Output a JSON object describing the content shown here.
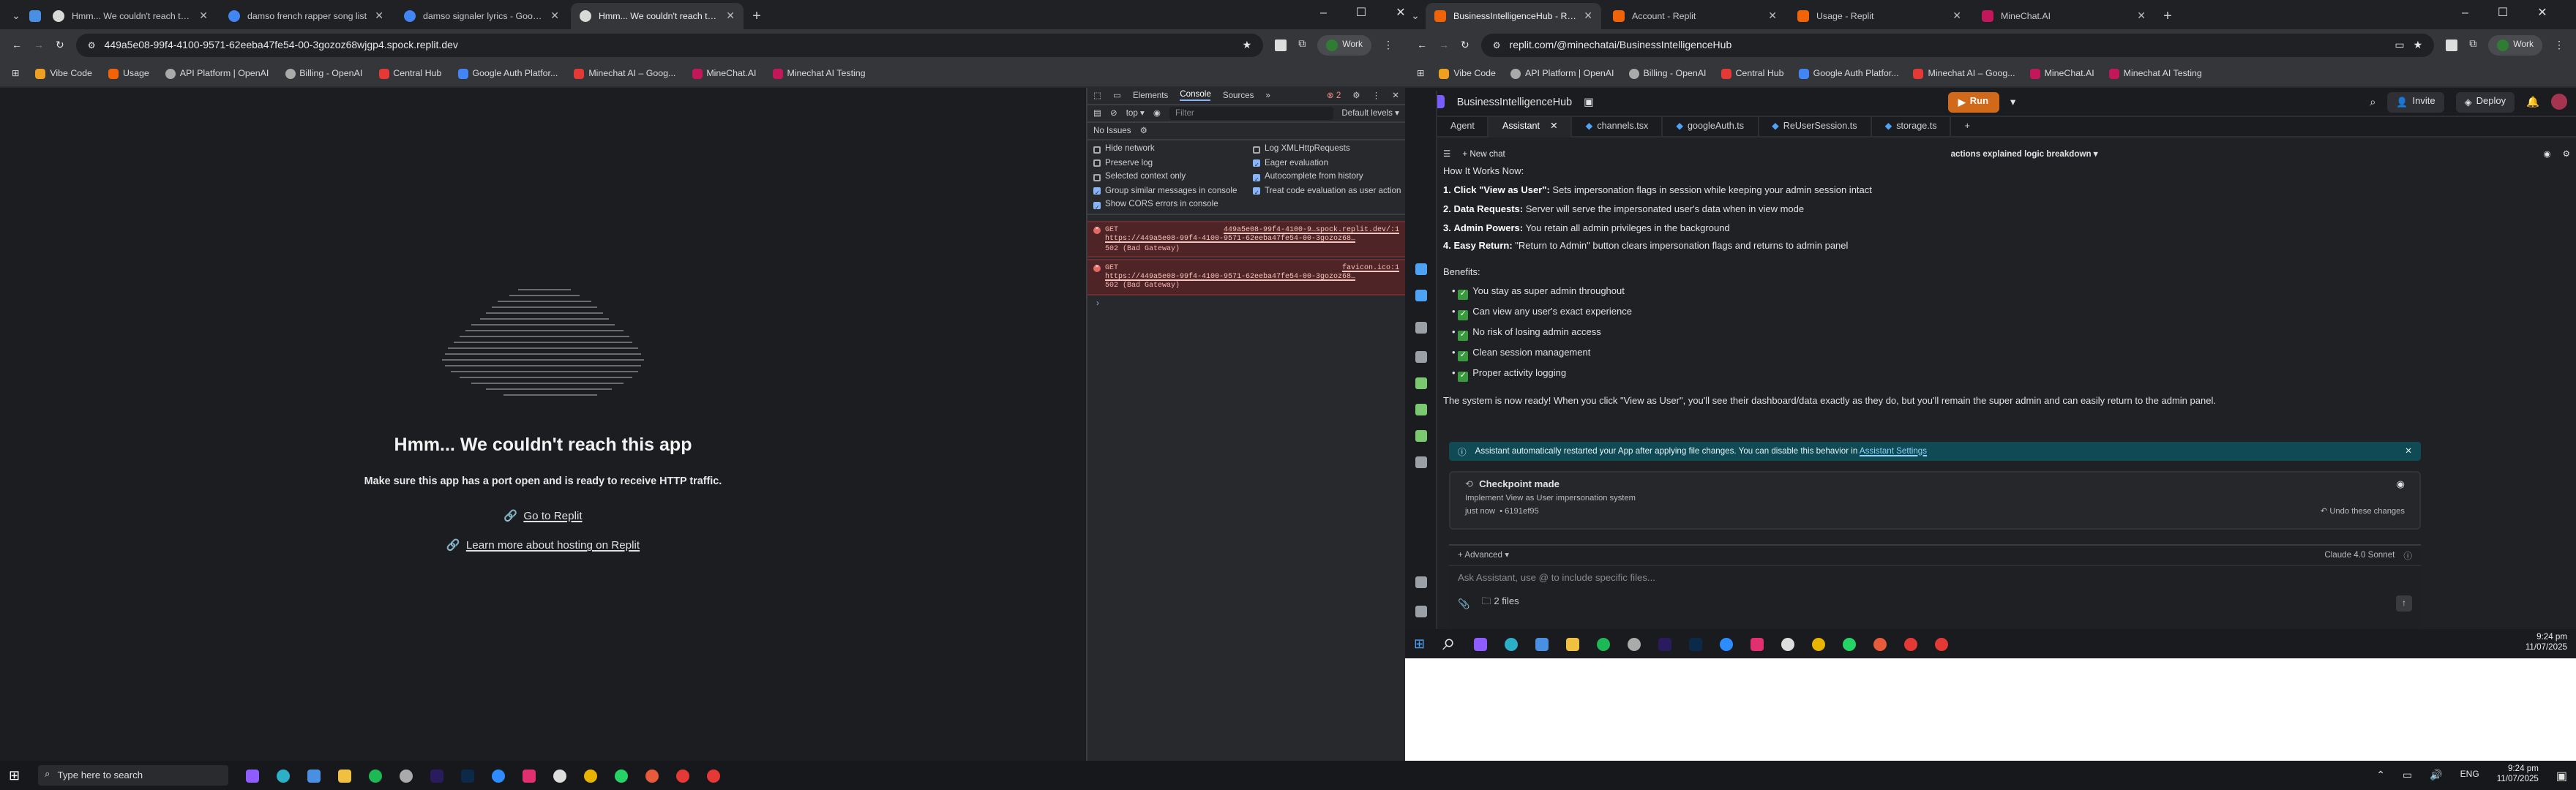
{
  "left_window": {
    "tabs": [
      {
        "title": "Hmm... We couldn't reach this",
        "active": false
      },
      {
        "title": "damso french rapper song list",
        "active": false
      },
      {
        "title": "damso signaler lyrics - Google",
        "active": false
      },
      {
        "title": "Hmm... We couldn't reach this",
        "active": true
      }
    ],
    "url": "449a5e08-99f4-4100-9571-62eeba47fe54-00-3gozoz68wjgp4.spock.replit.dev",
    "profile": "Work",
    "bookmarks": [
      "Vibe Code",
      "Usage",
      "API Platform | OpenAI",
      "Billing - OpenAI",
      "Central Hub",
      "Google Auth Platfor...",
      "Minechat AI – Goog...",
      "MineChat.AI",
      "Minechat AI Testing"
    ],
    "error_page": {
      "title": "Hmm... We couldn't reach this app",
      "subtitle": "Make sure this app has a port open and is ready to receive HTTP traffic.",
      "link1": "Go to Replit",
      "link2": "Learn more about hosting on Replit"
    },
    "devtools": {
      "tabs": [
        "Elements",
        "Console",
        "Sources"
      ],
      "active_tab": "Console",
      "error_count": "2",
      "context": "top",
      "filter_placeholder": "Filter",
      "levels": "Default levels",
      "no_issues": "No Issues",
      "settings": [
        {
          "label": "Hide network",
          "checked": false
        },
        {
          "label": "Log XMLHttpRequests",
          "checked": false
        },
        {
          "label": "Preserve log",
          "checked": false
        },
        {
          "label": "Eager evaluation",
          "checked": true
        },
        {
          "label": "Selected context only",
          "checked": false
        },
        {
          "label": "Autocomplete from history",
          "checked": true
        },
        {
          "label": "Group similar messages in console",
          "checked": true
        },
        {
          "label": "Treat code evaluation as user action",
          "checked": true
        },
        {
          "label": "Show CORS errors in console",
          "checked": true
        }
      ],
      "errors": [
        {
          "method": "GET",
          "source": "449a5e08-99f4-4100-9…spock.replit.dev/:1",
          "url": "https://449a5e08-99f4-4100-9571-62eeba47fe54-00-3gozoz68…",
          "status": "502 (Bad Gateway)"
        },
        {
          "method": "GET",
          "source": "favicon.ico:1",
          "url": "https://449a5e08-99f4-4100-9571-62eeba47fe54-00-3gozoz68…",
          "status": "502 (Bad Gateway)"
        }
      ],
      "prompt": "›"
    }
  },
  "right_window": {
    "tabs": [
      {
        "title": "BusinessIntelligenceHub - Repl",
        "active": true
      },
      {
        "title": "Account - Replit",
        "active": false
      },
      {
        "title": "Usage - Replit",
        "active": false
      },
      {
        "title": "MineChat.AI",
        "active": false
      }
    ],
    "url": "replit.com/@minechatai/BusinessIntelligenceHub",
    "profile": "Work",
    "bookmarks": [
      "Vibe Code",
      "API Platform | OpenAI",
      "Billing - OpenAI",
      "Central Hub",
      "Google Auth Platfor...",
      "Minechat AI – Goog...",
      "MineChat.AI",
      "Minechat AI Testing"
    ],
    "project": "BusinessIntelligenceHub",
    "run_label": "Run",
    "invite_label": "Invite",
    "deploy_label": "Deploy",
    "file_tabs": [
      "Agent",
      "Assistant",
      "channels.tsx",
      "googleAuth.ts",
      "ReUserSession.ts",
      "storage.ts"
    ],
    "active_file_tab": "Assistant",
    "new_chat": "New chat",
    "chat_title": "actions explained logic breakdown",
    "chat": {
      "heading": "How It Works Now:",
      "steps": [
        {
          "n": "1.",
          "bold": "Click \"View as User\":",
          "text": " Sets impersonation flags in session while keeping your admin session intact"
        },
        {
          "n": "2.",
          "bold": "Data Requests:",
          "text": " Server will serve the impersonated user's data when in view mode"
        },
        {
          "n": "3.",
          "bold": "Admin Powers:",
          "text": " You retain all admin privileges in the background"
        },
        {
          "n": "4.",
          "bold": "Easy Return:",
          "text": " \"Return to Admin\" button clears impersonation flags and returns to admin panel"
        }
      ],
      "benefits_heading": "Benefits:",
      "benefits": [
        "You stay as super admin throughout",
        "Can view any user's exact experience",
        "No risk of losing admin access",
        "Clean session management",
        "Proper activity logging"
      ],
      "summary": "The system is now ready! When you click \"View as User\", you'll see their dashboard/data exactly as they do, but you'll remain the super admin and can easily return to the admin panel."
    },
    "notice": "Assistant automatically restarted your App after applying file changes. You can disable this behavior in",
    "notice_link": "Assistant Settings",
    "checkpoint": {
      "title": "Checkpoint made",
      "desc": "Implement View as User impersonation system",
      "time": "just now",
      "hash": "• 6191ef95",
      "undo": "Undo these changes"
    },
    "advanced": "Advanced",
    "model": "Claude 4.0 Sonnet",
    "input_placeholder": "Ask Assistant, use @ to include specific files...",
    "files": "2 files"
  },
  "taskbar_right": {
    "time": "9:24 pm",
    "date": "11/07/2025"
  },
  "taskbar_main": {
    "search_placeholder": "Type here to search",
    "lang": "ENG",
    "time": "9:24 pm",
    "date": "11/07/2025"
  },
  "colors": {
    "run": "#d06a1a",
    "notice": "#0f4a55",
    "error_bg": "#4e2426",
    "check": "#3a9a3f"
  }
}
